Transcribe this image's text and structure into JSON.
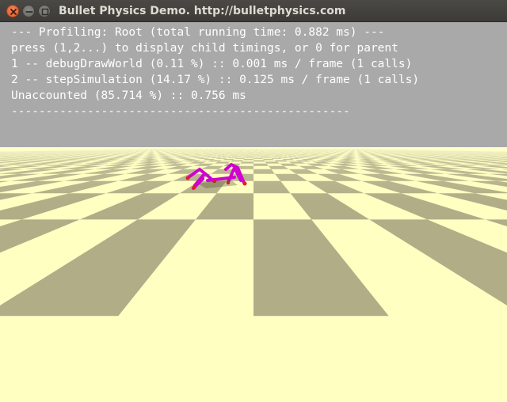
{
  "window": {
    "title": "Bullet Physics Demo. http://bulletphysics.com"
  },
  "profiler": {
    "lines": [
      "--- Profiling: Root (total running time: 0.882 ms) ---",
      "press (1,2...) to display child timings, or 0 for parent",
      "1 -- debugDrawWorld (0.11 %) :: 0.001 ms / frame (1 calls)",
      "2 -- stepSimulation (14.17 %) :: 0.125 ms / frame (1 calls)",
      "Unaccounted (85.714 %) :: 0.756 ms",
      "-------------------------------------------------"
    ]
  },
  "colors": {
    "sky": "#a9a9a9",
    "floor_light": "#ffffc2",
    "floor_dark": "#b0ad87",
    "robot_legs": "#d000d0",
    "robot_feet": "#e02020"
  },
  "icons": {
    "close": "close-icon",
    "minimize": "minimize-icon",
    "maximize": "maximize-icon"
  }
}
